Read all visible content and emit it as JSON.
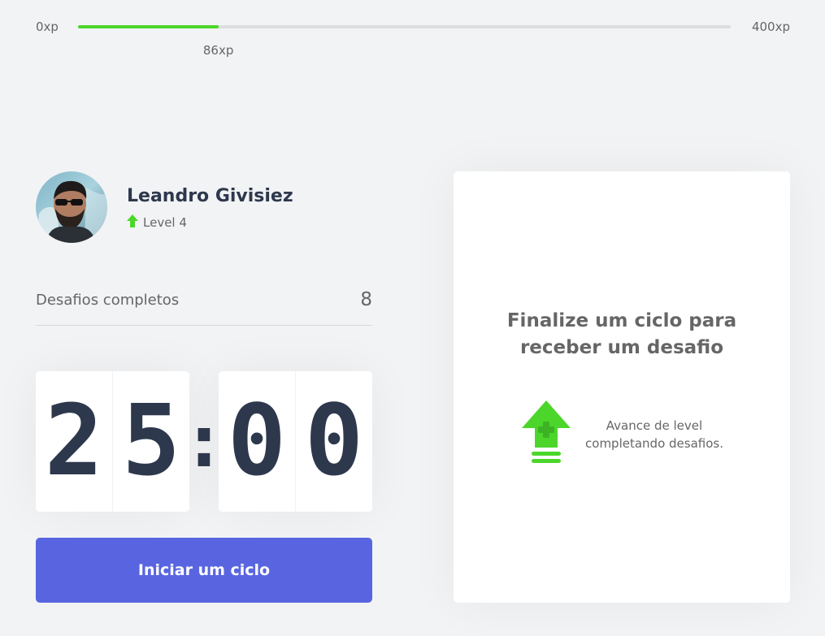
{
  "xp": {
    "min_label": "0xp",
    "max_label": "400xp",
    "current_label": "86xp",
    "current": 86,
    "max": 400,
    "color": "#4CD62B"
  },
  "profile": {
    "name": "Leandro Givisiez",
    "level_label": "Level 4",
    "avatar_icon": "user-avatar",
    "level_icon": "level-up-arrow-icon"
  },
  "challenges_completed": {
    "label": "Desafios completos",
    "count": "8"
  },
  "countdown": {
    "minute_left": "2",
    "minute_right": "5",
    "separator": ":",
    "second_left": "0",
    "second_right": "0"
  },
  "start_button": {
    "label": "Iniciar um ciclo",
    "color": "#5965E0"
  },
  "challenge_box": {
    "title": "Finalize um ciclo para receber um desafio",
    "hint": "Avance de level completando desafios.",
    "hint_icon": "level-up-icon"
  },
  "colors": {
    "background": "#F2F3F5",
    "title": "#2E384D",
    "text": "#666666",
    "green": "#4CD62B",
    "blue": "#5965E0"
  }
}
